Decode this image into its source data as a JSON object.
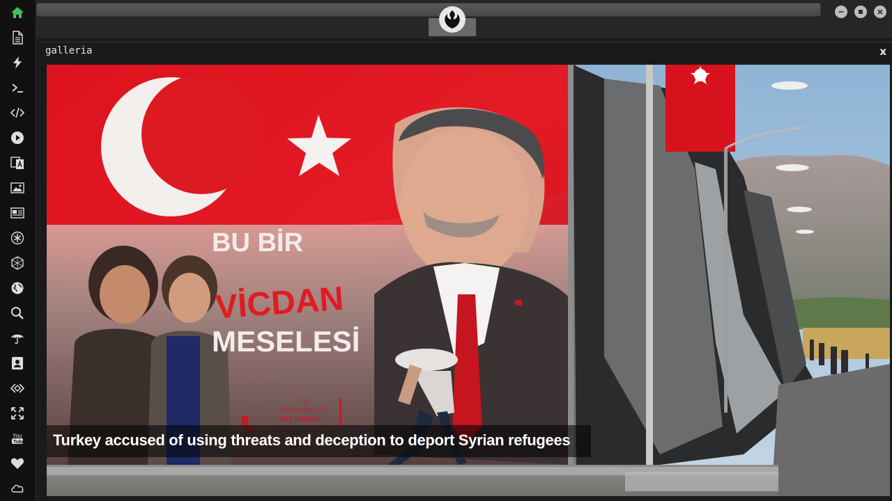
{
  "window": {
    "buttons": [
      "minimize",
      "maximize",
      "close"
    ]
  },
  "sidebar": {
    "items": [
      {
        "icon": "home-icon",
        "color": "#3fbf5f"
      },
      {
        "icon": "document-icon"
      },
      {
        "icon": "lightning-icon"
      },
      {
        "icon": "terminal-icon"
      },
      {
        "icon": "code-icon"
      },
      {
        "icon": "play-icon"
      },
      {
        "icon": "translate-icon"
      },
      {
        "icon": "image-icon"
      },
      {
        "icon": "news-icon"
      },
      {
        "icon": "asterisk-icon"
      },
      {
        "icon": "hexagon-icon"
      },
      {
        "icon": "globe-icon"
      },
      {
        "icon": "search-icon"
      },
      {
        "icon": "umbrella-icon"
      },
      {
        "icon": "contact-icon"
      },
      {
        "icon": "code-diamond-icon"
      },
      {
        "icon": "expand-icon"
      },
      {
        "icon": "youtube-icon"
      },
      {
        "icon": "heart-icon"
      },
      {
        "icon": "cloud-icon"
      }
    ]
  },
  "topbar": {
    "logo_icon": "rebel-alliance-icon"
  },
  "gallery": {
    "title": "galleria",
    "close_label": "x",
    "caption": "Turkey accused of using threats and deception to deport Syrian refugees",
    "billboard_text": {
      "line1": "BU BİR",
      "line2": "VİCDAN",
      "line3": "MESELESİ",
      "small1": "T.C.",
      "small2": "İÇİŞLERİ BAKANLIĞI",
      "small3": "GÖÇ İDARESİ"
    }
  },
  "colors": {
    "accent": "#3fbf5f",
    "flag_red": "#e0141f"
  }
}
